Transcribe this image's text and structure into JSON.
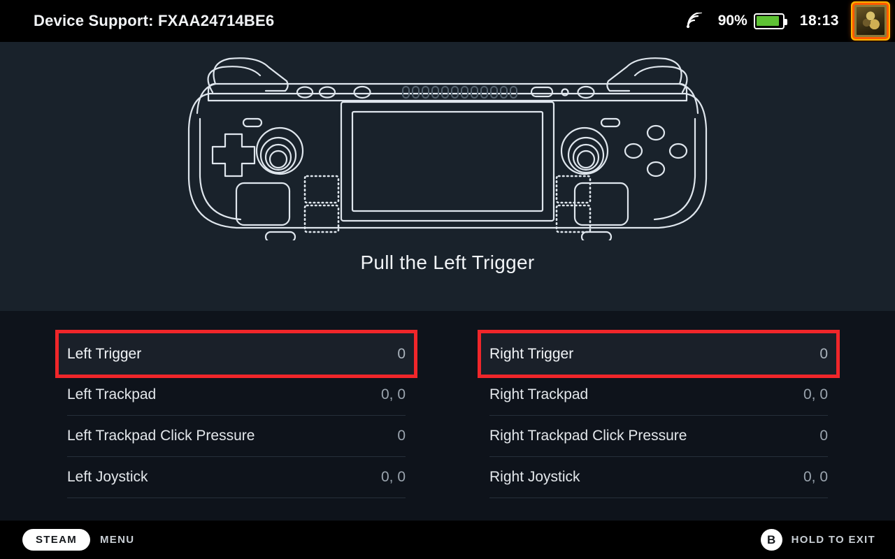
{
  "topbar": {
    "title": "Device Support: FXAA24714BE6",
    "wifi_icon": "wifi-signal-icon",
    "battery_percent": "90%",
    "battery_level": 90,
    "battery_color": "#5ec234",
    "clock": "18:13",
    "avatar": "user-avatar"
  },
  "hero": {
    "device_diagram": "steam-deck-outline-diagram",
    "prompt": "Pull the Left Trigger"
  },
  "panel": {
    "left_column": [
      {
        "label": "Left Trigger",
        "value": "0",
        "highlighted": true
      },
      {
        "label": "Left Trackpad",
        "value": "0, 0",
        "highlighted": false
      },
      {
        "label": "Left Trackpad Click Pressure",
        "value": "0",
        "highlighted": false
      },
      {
        "label": "Left Joystick",
        "value": "0, 0",
        "highlighted": false
      }
    ],
    "right_column": [
      {
        "label": "Right Trigger",
        "value": "0",
        "highlighted": true
      },
      {
        "label": "Right Trackpad",
        "value": "0, 0",
        "highlighted": false
      },
      {
        "label": "Right Trackpad Click Pressure",
        "value": "0",
        "highlighted": false
      },
      {
        "label": "Right Joystick",
        "value": "0, 0",
        "highlighted": false
      }
    ],
    "highlight_color": "#f0262a"
  },
  "footer": {
    "steam_label": "STEAM",
    "menu_label": "MENU",
    "exit_button_glyph": "B",
    "exit_label": "HOLD TO EXIT"
  },
  "colors": {
    "hero_bg": "#19222b",
    "panel_bg": "#0e131b",
    "bar_bg": "#000000",
    "outline": "#dfe6ed",
    "accent_red": "#f0262a"
  }
}
